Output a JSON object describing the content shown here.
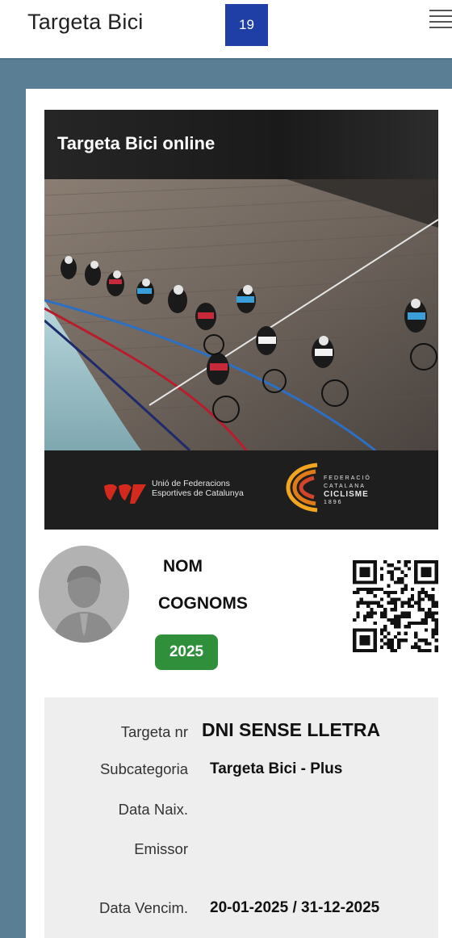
{
  "header": {
    "title": "Targeta Bici",
    "badge": "19",
    "menu_icon": "hamburger-menu-icon"
  },
  "banner": {
    "title": "Targeta Bici online",
    "ufec_line1": "Unió de Federacions",
    "ufec_line2": "Esportives de Catalunya",
    "fcc_line1": "FEDERACIÓ",
    "fcc_line2": "CATALANA",
    "fcc_line3": "CICLISME",
    "fcc_line4": "1896"
  },
  "holder": {
    "name": "NOM",
    "surname": "COGNOMS",
    "year": "2025",
    "year_color": "#2f8f3a"
  },
  "details": {
    "card_number_label": "Targeta nr",
    "card_number_value": "DNI SENSE LLETRA",
    "subcategory_label": "Subcategoria",
    "subcategory_value": "Targeta Bici - Plus",
    "birth_date_label": "Data Naix.",
    "birth_date_value": "",
    "issuer_label": "Emissor",
    "issuer_value": "",
    "expiry_label": "Data Vencim.",
    "expiry_value": "20-01-2025 / 31-12-2025"
  },
  "colors": {
    "badge": "#1f3fa6",
    "frame": "#5a7f95"
  }
}
